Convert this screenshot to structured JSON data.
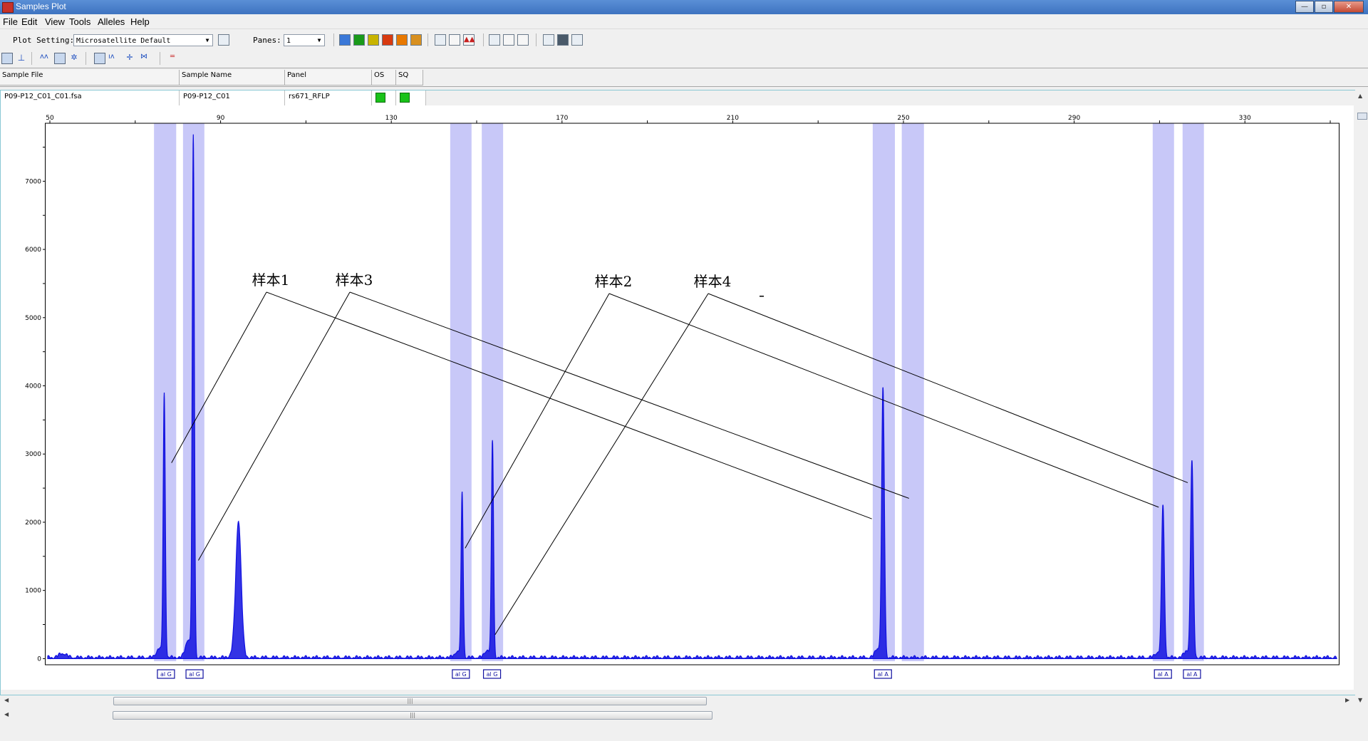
{
  "window": {
    "title": "Samples Plot",
    "controls": [
      "—",
      "▫",
      "✕"
    ]
  },
  "menu": [
    "File",
    "Edit",
    "View",
    "Tools",
    "Alleles",
    "Help"
  ],
  "toolbar": {
    "plot_setting_label": "Plot Setting:",
    "plot_setting_value": "Microsatellite Default",
    "panes_label": "Panes:",
    "panes_value": "1",
    "color_buttons": [
      "#3a78d8",
      "#1a9a1a",
      "#c8b400",
      "#d83a10",
      "#e87800",
      "#d89020"
    ]
  },
  "table": {
    "columns": [
      "Sample File",
      "Sample Name",
      "Panel",
      "OS",
      "SQ"
    ],
    "row": {
      "sample_file": "P09-P12_C01_C01.fsa",
      "sample_name": "P09-P12_C01",
      "panel": "rs671_RFLP",
      "os_color": "#19c219",
      "sq_color": "#19c219"
    }
  },
  "chart_data": {
    "type": "line",
    "series": [
      {
        "color": "#1010e0",
        "values": []
      }
    ],
    "x_ticks": [
      50,
      90,
      130,
      170,
      210,
      250,
      290,
      330
    ],
    "y_ticks": [
      0,
      1000,
      2000,
      3000,
      4000,
      5000,
      6000,
      7000
    ],
    "xlim": [
      49,
      352
    ],
    "ylim": [
      -90,
      7850
    ],
    "peaks": [
      {
        "x": 76.8,
        "h": 3850,
        "w": 0.35
      },
      {
        "x": 83.6,
        "h": 7600,
        "w": 0.35
      },
      {
        "x": 94.2,
        "h": 2000,
        "w": 0.9
      },
      {
        "x": 146.6,
        "h": 2400,
        "w": 0.35
      },
      {
        "x": 153.7,
        "h": 3200,
        "w": 0.35
      },
      {
        "x": 245.2,
        "h": 3950,
        "w": 0.45
      },
      {
        "x": 310.8,
        "h": 2250,
        "w": 0.45
      },
      {
        "x": 317.6,
        "h": 2900,
        "w": 0.45
      }
    ],
    "bins": [
      {
        "from": 74.4,
        "to": 79.6
      },
      {
        "from": 81.2,
        "to": 86.2
      },
      {
        "from": 143.8,
        "to": 148.8
      },
      {
        "from": 151.2,
        "to": 156.2
      },
      {
        "from": 242.8,
        "to": 248.0
      },
      {
        "from": 249.6,
        "to": 254.8
      },
      {
        "from": 308.4,
        "to": 313.4
      },
      {
        "from": 315.4,
        "to": 320.4
      }
    ],
    "allele_labels": [
      {
        "x": 77.2,
        "text": "al G"
      },
      {
        "x": 83.9,
        "text": "al G"
      },
      {
        "x": 146.3,
        "text": "al G"
      },
      {
        "x": 153.6,
        "text": "al G"
      },
      {
        "x": 245.2,
        "text": "al A"
      },
      {
        "x": 310.8,
        "text": "al A"
      },
      {
        "x": 317.6,
        "text": "al A"
      }
    ],
    "annotations": [
      {
        "text": "样本1",
        "targets": [
          [
            78.5,
            2870
          ],
          [
            242.6,
            2050
          ]
        ]
      },
      {
        "text": "样本3",
        "targets": [
          [
            84.8,
            1440
          ],
          [
            251.3,
            2350
          ]
        ]
      },
      {
        "text": "样本2",
        "targets": [
          [
            147.3,
            1620
          ],
          [
            309.8,
            2220
          ]
        ]
      },
      {
        "text": "样本4",
        "targets": [
          [
            154.3,
            350
          ],
          [
            316.6,
            2580
          ]
        ]
      }
    ]
  }
}
